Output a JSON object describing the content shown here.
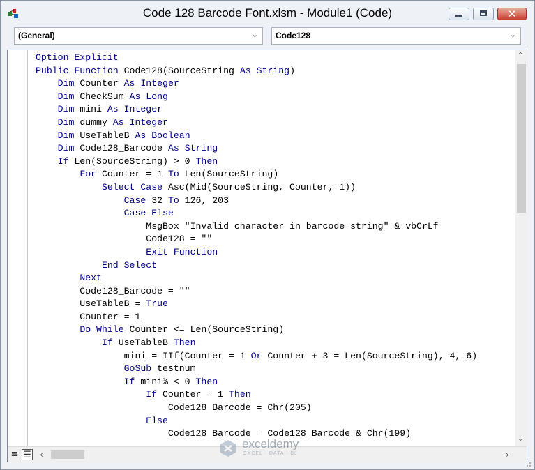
{
  "window": {
    "title": "Code 128 Barcode Font.xlsm - Module1 (Code)",
    "icon": "vba-project-icon",
    "buttons": {
      "minimize": "minimize-icon",
      "maximize": "maximize-icon",
      "close": "✕"
    }
  },
  "object_combo": {
    "value": "(General)"
  },
  "procedure_combo": {
    "value": "Code128"
  },
  "code": {
    "lines": [
      [
        {
          "t": "Option Explicit",
          "k": true
        }
      ],
      [
        {
          "t": "Public Function",
          "k": true
        },
        {
          "t": " Code128(SourceString "
        },
        {
          "t": "As String",
          "k": true
        },
        {
          "t": ")"
        }
      ],
      [
        {
          "t": "    "
        },
        {
          "t": "Dim",
          "k": true
        },
        {
          "t": " Counter "
        },
        {
          "t": "As Integer",
          "k": true
        }
      ],
      [
        {
          "t": "    "
        },
        {
          "t": "Dim",
          "k": true
        },
        {
          "t": " CheckSum "
        },
        {
          "t": "As Long",
          "k": true
        }
      ],
      [
        {
          "t": "    "
        },
        {
          "t": "Dim",
          "k": true
        },
        {
          "t": " mini "
        },
        {
          "t": "As Integer",
          "k": true
        }
      ],
      [
        {
          "t": "    "
        },
        {
          "t": "Dim",
          "k": true
        },
        {
          "t": " dummy "
        },
        {
          "t": "As Integer",
          "k": true
        }
      ],
      [
        {
          "t": "    "
        },
        {
          "t": "Dim",
          "k": true
        },
        {
          "t": " UseTableB "
        },
        {
          "t": "As Boolean",
          "k": true
        }
      ],
      [
        {
          "t": "    "
        },
        {
          "t": "Dim",
          "k": true
        },
        {
          "t": " Code128_Barcode "
        },
        {
          "t": "As String",
          "k": true
        }
      ],
      [
        {
          "t": "    "
        },
        {
          "t": "If",
          "k": true
        },
        {
          "t": " Len(SourceString) > 0 "
        },
        {
          "t": "Then",
          "k": true
        }
      ],
      [
        {
          "t": "        "
        },
        {
          "t": "For",
          "k": true
        },
        {
          "t": " Counter = 1 "
        },
        {
          "t": "To",
          "k": true
        },
        {
          "t": " Len(SourceString)"
        }
      ],
      [
        {
          "t": "            "
        },
        {
          "t": "Select Case",
          "k": true
        },
        {
          "t": " Asc(Mid(SourceString, Counter, 1))"
        }
      ],
      [
        {
          "t": "                "
        },
        {
          "t": "Case",
          "k": true
        },
        {
          "t": " 32 "
        },
        {
          "t": "To",
          "k": true
        },
        {
          "t": " 126, 203"
        }
      ],
      [
        {
          "t": "                "
        },
        {
          "t": "Case Else",
          "k": true
        }
      ],
      [
        {
          "t": "                    MsgBox \"Invalid character in barcode string\" & vbCrLf"
        }
      ],
      [
        {
          "t": "                    Code128 = \"\""
        }
      ],
      [
        {
          "t": "                    "
        },
        {
          "t": "Exit Function",
          "k": true
        }
      ],
      [
        {
          "t": "            "
        },
        {
          "t": "End Select",
          "k": true
        }
      ],
      [
        {
          "t": "        "
        },
        {
          "t": "Next",
          "k": true
        }
      ],
      [
        {
          "t": "        Code128_Barcode = \"\""
        }
      ],
      [
        {
          "t": "        UseTableB = "
        },
        {
          "t": "True",
          "k": true
        }
      ],
      [
        {
          "t": "        Counter = 1"
        }
      ],
      [
        {
          "t": "        "
        },
        {
          "t": "Do While",
          "k": true
        },
        {
          "t": " Counter <= Len(SourceString)"
        }
      ],
      [
        {
          "t": "            "
        },
        {
          "t": "If",
          "k": true
        },
        {
          "t": " UseTableB "
        },
        {
          "t": "Then",
          "k": true
        }
      ],
      [
        {
          "t": "                mini = IIf(Counter = 1 "
        },
        {
          "t": "Or",
          "k": true
        },
        {
          "t": " Counter + 3 = Len(SourceString), 4, 6)"
        }
      ],
      [
        {
          "t": "                "
        },
        {
          "t": "GoSub",
          "k": true
        },
        {
          "t": " testnum"
        }
      ],
      [
        {
          "t": "                "
        },
        {
          "t": "If",
          "k": true
        },
        {
          "t": " mini% < 0 "
        },
        {
          "t": "Then",
          "k": true
        }
      ],
      [
        {
          "t": "                    "
        },
        {
          "t": "If",
          "k": true
        },
        {
          "t": " Counter = 1 "
        },
        {
          "t": "Then",
          "k": true
        }
      ],
      [
        {
          "t": "                        Code128_Barcode = Chr(205)"
        }
      ],
      [
        {
          "t": "                    "
        },
        {
          "t": "Else",
          "k": true
        }
      ],
      [
        {
          "t": "                        Code128_Barcode = Code128_Barcode & Chr(199)"
        }
      ]
    ]
  },
  "view_buttons": {
    "procedure_view": "≡",
    "full_module_view": "☰"
  },
  "watermark": {
    "name": "exceldemy",
    "tagline": "EXCEL · DATA · BI"
  },
  "colors": {
    "keyword": "#00008b",
    "text": "#000000",
    "chrome": "#eef2f7",
    "close_button": "#c7402e"
  }
}
